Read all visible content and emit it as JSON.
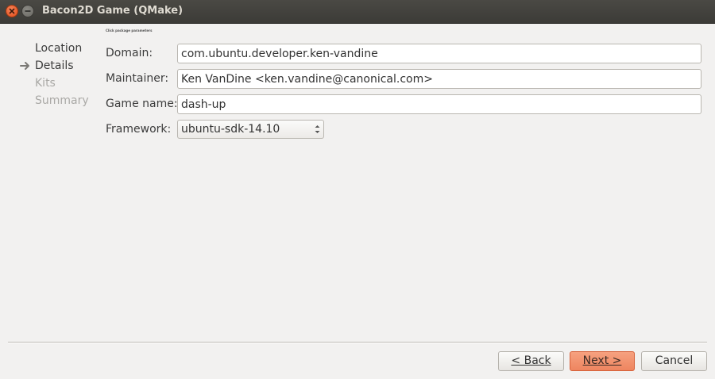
{
  "window": {
    "title": "Bacon2D Game (QMake)"
  },
  "steps": [
    {
      "label": "Location",
      "state": "done"
    },
    {
      "label": "Details",
      "state": "current"
    },
    {
      "label": "Kits",
      "state": "pending"
    },
    {
      "label": "Summary",
      "state": "pending"
    }
  ],
  "form": {
    "heading": "Click package parameters",
    "domain": {
      "label": "Domain:",
      "value": "com.ubuntu.developer.ken-vandine"
    },
    "maintainer": {
      "label": "Maintainer:",
      "value": "Ken VanDine <ken.vandine@canonical.com>"
    },
    "game_name": {
      "label": "Game name:",
      "value": "dash-up"
    },
    "framework": {
      "label": "Framework:",
      "value": "ubuntu-sdk-14.10"
    }
  },
  "buttons": {
    "back": "< Back",
    "next": "Next >",
    "cancel": "Cancel"
  },
  "colors": {
    "accent": "#ee8560",
    "titlebar": "#3c3b37",
    "background": "#f2f1f0"
  }
}
